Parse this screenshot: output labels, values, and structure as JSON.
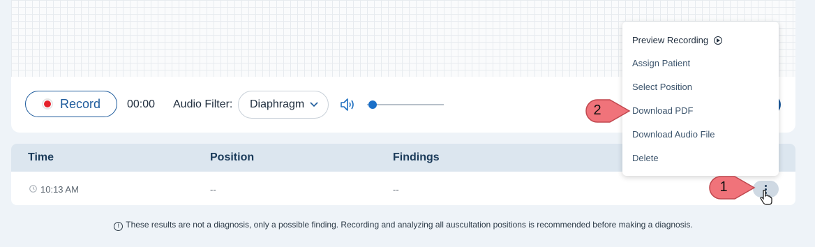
{
  "recorder": {
    "record_label": "Record",
    "timer": "00:00",
    "filter_label": "Audio Filter:",
    "filter_value": "Diaphragm",
    "volume_level": 0.05
  },
  "table": {
    "headers": [
      "Time",
      "Position",
      "Findings"
    ],
    "rows": [
      {
        "time": "10:13 AM",
        "position": "--",
        "findings": "--"
      }
    ]
  },
  "disclaimer": "These results are not a diagnosis, only a possible finding. Recording and analyzing all auscultation positions is recommended before making a diagnosis.",
  "menu": {
    "items": [
      "Preview Recording",
      "Assign Patient",
      "Select Position",
      "Download PDF",
      "Download Audio File",
      "Delete"
    ]
  },
  "callouts": [
    "1",
    "2"
  ],
  "colors": {
    "accent": "#1e5b9c",
    "record_dot": "#e5202a",
    "callout": "#f0737a",
    "page_bg": "#eef3f8"
  },
  "icons": [
    "record-icon",
    "chevron-down-icon",
    "volume-icon",
    "clock-icon",
    "more-vertical-icon",
    "info-icon",
    "play-circle-icon",
    "hand-cursor-icon"
  ]
}
